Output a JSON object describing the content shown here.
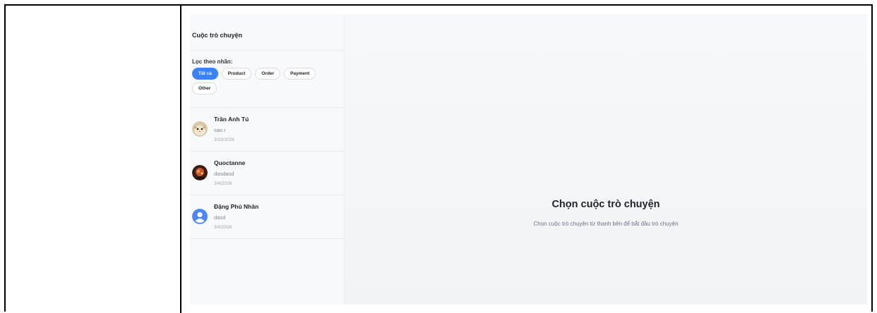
{
  "sidebar": {
    "title": "Cuộc trò chuyện",
    "filter_label": "Lọc theo nhãn:",
    "filters": [
      "Tất cả",
      "Product",
      "Order",
      "Payment",
      "Other"
    ],
    "active_filter": "Tất cả",
    "conversations": [
      {
        "name": "Trần Anh Tú",
        "last_message": "sao r",
        "date": "3/23/2026",
        "avatar": "photo-avatar"
      },
      {
        "name": "Quoctanne",
        "last_message": "dasdasd",
        "date": "3/4/2026",
        "avatar": "photo-avatar"
      },
      {
        "name": "Đặng Phú Nhân",
        "last_message": "dasd",
        "date": "3/4/2026",
        "avatar": "default-user-icon"
      }
    ]
  },
  "main": {
    "empty_title": "Chọn cuộc trò chuyện",
    "empty_subtitle": "Chọn cuộc trò chuyện từ thanh bên để bắt đầu trò chuyện"
  },
  "colors": {
    "accent": "#3b82f6",
    "default_avatar": "#4f86f7"
  }
}
